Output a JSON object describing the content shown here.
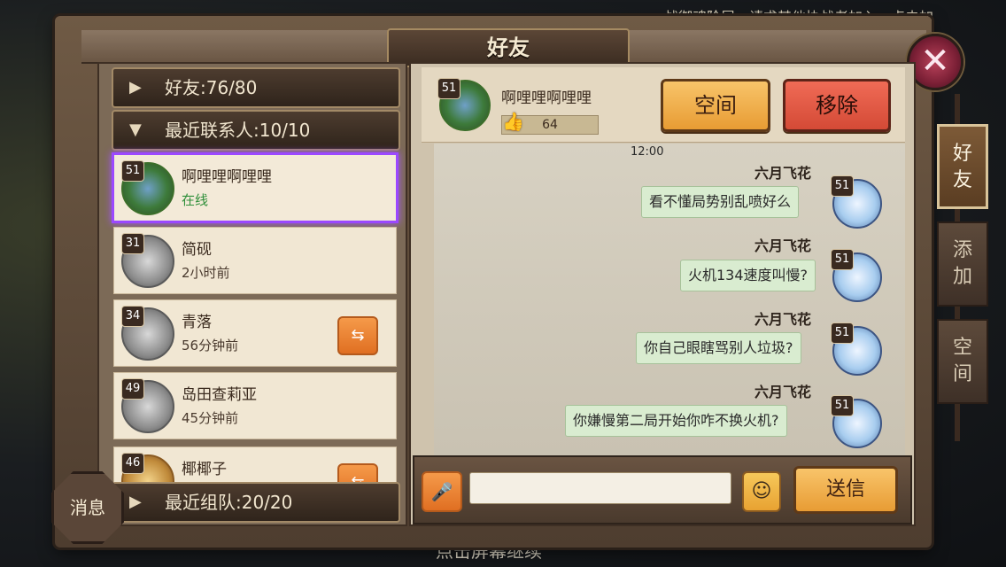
{
  "background": {
    "top_text": "战御魂阶层，请求其他协战者加入，点击加",
    "bottom_text": "点击屏幕继续"
  },
  "window": {
    "title": "好友"
  },
  "left": {
    "groups": [
      {
        "label": "好友:76/80",
        "expanded": false
      },
      {
        "label": "最近联系人:10/10",
        "expanded": true
      },
      {
        "label": "最近组队:20/20",
        "expanded": false
      }
    ],
    "friends": [
      {
        "level": "51",
        "name": "啊哩哩啊哩哩",
        "status": "在线",
        "online": true,
        "invite": false
      },
      {
        "level": "31",
        "name": "简砚",
        "status": "2小时前",
        "online": false,
        "invite": false
      },
      {
        "level": "34",
        "name": "青落",
        "status": "56分钟前",
        "online": false,
        "invite": true
      },
      {
        "level": "49",
        "name": "岛田查莉亚",
        "status": "45分钟前",
        "online": false,
        "invite": false
      },
      {
        "level": "46",
        "name": "椰椰子",
        "status": "",
        "online": false,
        "invite": true
      }
    ],
    "message_badge": "消息"
  },
  "profile": {
    "level": "51",
    "name": "啊哩哩啊哩哩",
    "likes": "64",
    "space_button": "空间",
    "remove_button": "移除"
  },
  "chat": {
    "timestamp": "12:00",
    "messages": [
      {
        "sender": "六月飞花",
        "text": "看不懂局势别乱喷好么",
        "level": "51"
      },
      {
        "sender": "六月飞花",
        "text": "火机134速度叫慢?",
        "level": "51"
      },
      {
        "sender": "六月飞花",
        "text": "你自己眼瞎骂别人垃圾?",
        "level": "51"
      },
      {
        "sender": "六月飞花",
        "text": "你嫌慢第二局开始你咋不换火机?",
        "level": "51"
      }
    ]
  },
  "input": {
    "send_button": "送信",
    "value": ""
  },
  "side_tabs": [
    {
      "label": "好友",
      "active": true
    },
    {
      "label": "添加",
      "active": false
    },
    {
      "label": "空间",
      "active": false
    }
  ],
  "colors": {
    "selected_border": "#9b48ff",
    "online": "#2f8f3a",
    "bubble": "#d9ecd0"
  }
}
